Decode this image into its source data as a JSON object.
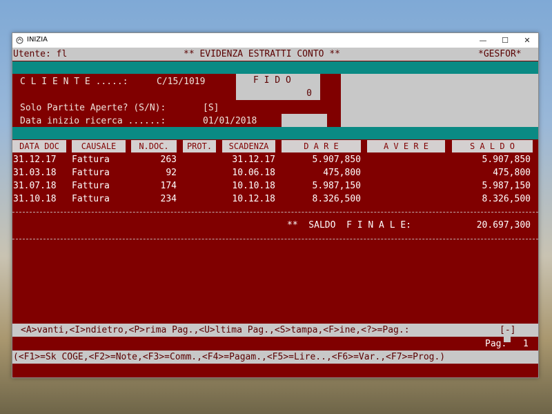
{
  "window": {
    "title": "INIZIA",
    "minimize": "—",
    "maximize": "☐",
    "close": "✕"
  },
  "status": {
    "user": "Utente: fl",
    "program_title": "** EVIDENZA ESTRATTI CONTO **",
    "company": "*GESFOR*"
  },
  "form": {
    "client_label": "C L I E N T E .....:",
    "client_value": "C/15/1019",
    "fido_label": "F I D O",
    "fido_value": "0",
    "open_label": "Solo Partite Aperte? (S/N):",
    "open_value": "[S]",
    "date_label": "Data inizio ricerca ......:",
    "date_value": "01/01/2018"
  },
  "table": {
    "columns": [
      "DATA DOC",
      "CAUSALE",
      "N.DOC.",
      "PROT.",
      "SCADENZA",
      "D A R E",
      "A V E R E",
      "S A L D O"
    ],
    "rows": [
      {
        "data": "31.12.17",
        "causale": "Fattura",
        "ndoc": "263",
        "prot": "",
        "scadenza": "31.12.17",
        "dare": "5.907,850",
        "avere": "",
        "saldo": "5.907,850"
      },
      {
        "data": "31.03.18",
        "causale": "Fattura",
        "ndoc": "92",
        "prot": "",
        "scadenza": "10.06.18",
        "dare": "475,800",
        "avere": "",
        "saldo": "475,800"
      },
      {
        "data": "31.07.18",
        "causale": "Fattura",
        "ndoc": "174",
        "prot": "",
        "scadenza": "10.10.18",
        "dare": "5.987,150",
        "avere": "",
        "saldo": "5.987,150"
      },
      {
        "data": "31.10.18",
        "causale": "Fattura",
        "ndoc": "234",
        "prot": "",
        "scadenza": "10.12.18",
        "dare": "8.326,500",
        "avere": "",
        "saldo": "8.326,500"
      }
    ],
    "total_label": "**  SALDO  F I N A L E:",
    "total_value": "20.697,300"
  },
  "footer": {
    "nav_text": "<A>vanti,<I>ndietro,<P>rima Pag.,<U>ltima Pag.,<S>tampa,<F>ine,<?>=Pag.:",
    "nav_input": "[-]",
    "page_label": "Pag.",
    "page_value": "1",
    "fkeys_text": "(<F1>=Sk COGE,<F2>=Note,<F3>=Comm.,<F4>=Pagam.,<F5>=Lire..,<F6>=Var.,<F7>=Prog.)"
  }
}
